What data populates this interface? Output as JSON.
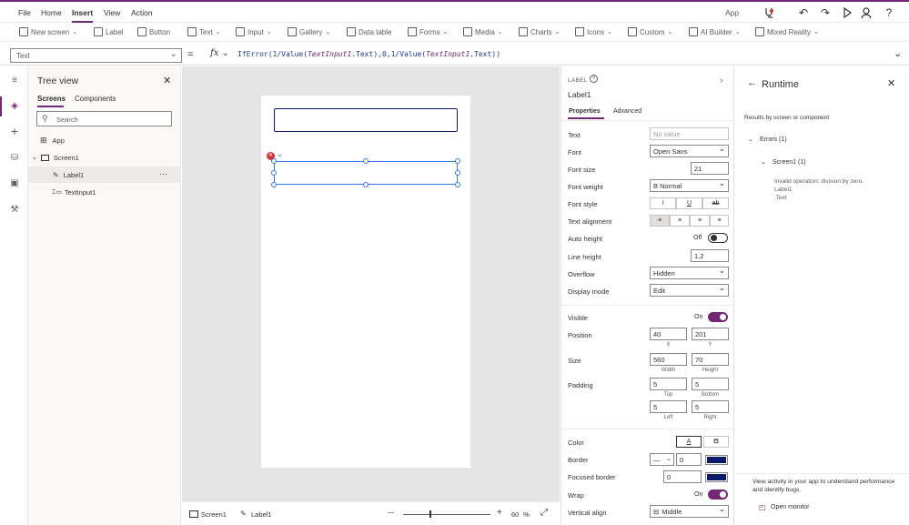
{
  "menu": {
    "file": "File",
    "home": "Home",
    "insert": "Insert",
    "view": "View",
    "action": "Action",
    "app": "App"
  },
  "ribbon": {
    "new_screen": "New screen",
    "label": "Label",
    "button": "Button",
    "text": "Text",
    "input": "Input",
    "gallery": "Gallery",
    "data_table": "Data table",
    "forms": "Forms",
    "media": "Media",
    "charts": "Charts",
    "icons": "Icons",
    "custom": "Custom",
    "ai_builder": "AI Builder",
    "mixed_reality": "Mixed Reality"
  },
  "formula_bar": {
    "property": "Text",
    "equals": "=",
    "fx": "fx",
    "formula": "IfError(1/Value(TextInput1.Text),0,1/Value(TextInput1.Text))"
  },
  "tree": {
    "title": "Tree view",
    "tab_screens": "Screens",
    "tab_components": "Components",
    "search_placeholder": "Search",
    "app": "App",
    "screen1": "Screen1",
    "label1": "Label1",
    "textinput1": "TextInput1",
    "more": "···"
  },
  "status": {
    "screen": "Screen1",
    "label": "Label1",
    "zoom": "60",
    "pct": "%",
    "minus": "—",
    "plus": "+"
  },
  "props": {
    "type": "LABEL",
    "name": "Label1",
    "tab_properties": "Properties",
    "tab_advanced": "Advanced",
    "text_label": "Text",
    "text_value": "No value",
    "font_label": "Font",
    "font_value": "Open Sans",
    "font_size_label": "Font size",
    "font_size_value": "21",
    "font_weight_label": "Font weight",
    "font_weight_value": "B  Normal",
    "font_style_label": "Font style",
    "text_align_label": "Text alignment",
    "auto_height_label": "Auto height",
    "auto_height_value": "Off",
    "line_height_label": "Line height",
    "line_height_value": "1.2",
    "overflow_label": "Overflow",
    "overflow_value": "Hidden",
    "display_mode_label": "Display mode",
    "display_mode_value": "Edit",
    "visible_label": "Visible",
    "visible_value": "On",
    "position_label": "Position",
    "x_value": "40",
    "y_value": "201",
    "x_caption": "X",
    "y_caption": "Y",
    "size_label": "Size",
    "width_value": "560",
    "height_value": "70",
    "width_caption": "Width",
    "height_caption": "Height",
    "padding_label": "Padding",
    "pad_top": "5",
    "pad_bottom": "5",
    "pad_left": "5",
    "pad_right": "5",
    "top_caption": "Top",
    "bottom_caption": "Bottom",
    "left_caption": "Left",
    "right_caption": "Right",
    "color_label": "Color",
    "border_label": "Border",
    "border_width": "0",
    "focused_border_label": "Focused border",
    "focused_border_width": "0",
    "wrap_label": "Wrap",
    "wrap_value": "On",
    "vertical_align_label": "Vertical align",
    "vertical_align_value": "Middle",
    "accent": "#742774",
    "border_color": "#0b1b6b"
  },
  "runtime": {
    "title": "Runtime",
    "subtitle": "Results by screen or component",
    "errors": "Errors (1)",
    "screen": "Screen1 (1)",
    "err_line1": "Invalid operation: division by zero.",
    "err_line2": "Label1",
    "err_line3": ".Text",
    "footer": "View activity in your app to understand performance and identify bugs.",
    "open_monitor": "Open monitor"
  }
}
